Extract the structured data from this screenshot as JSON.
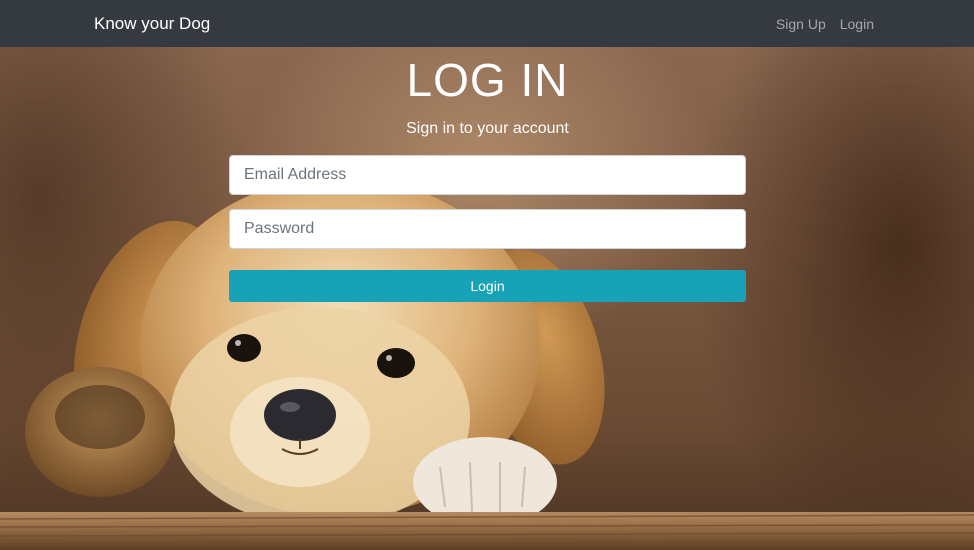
{
  "navbar": {
    "brand": "Know your Dog",
    "links": [
      {
        "label": "Sign Up"
      },
      {
        "label": "Login"
      }
    ]
  },
  "login": {
    "title": "LOG IN",
    "subtitle": "Sign in to your account",
    "email": {
      "placeholder": "Email Address",
      "value": ""
    },
    "password": {
      "placeholder": "Password",
      "value": ""
    },
    "submit_label": "Login"
  },
  "background": {
    "subject": "golden-retriever-puppy-photo"
  },
  "colors": {
    "navbar": "#343a40",
    "button": "#17a2b8",
    "nav_link": "rgba(255,255,255,0.55)"
  }
}
